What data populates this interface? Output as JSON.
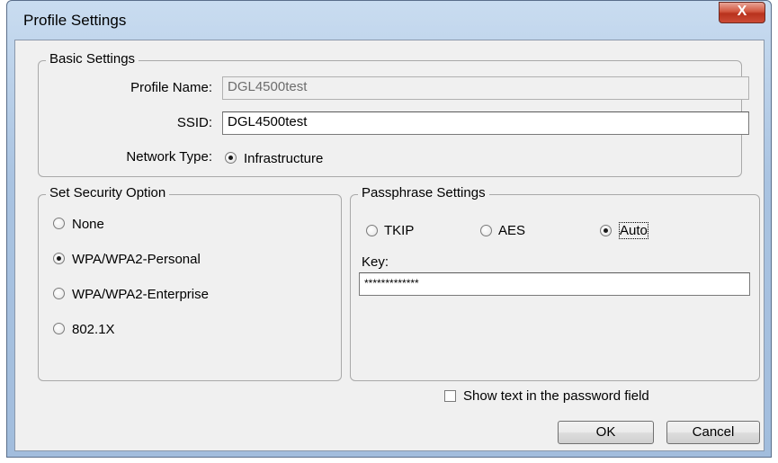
{
  "window": {
    "title": "Profile Settings",
    "close_glyph": "X"
  },
  "basic": {
    "legend": "Basic Settings",
    "profile_name_label": "Profile Name:",
    "profile_name_value": "DGL4500test",
    "ssid_label": "SSID:",
    "ssid_value": "DGL4500test",
    "network_type_label": "Network Type:",
    "network_type_option": "Infrastructure"
  },
  "security": {
    "legend": "Set Security Option",
    "options": [
      "None",
      "WPA/WPA2-Personal",
      "WPA/WPA2-Enterprise",
      "802.1X"
    ],
    "selected": "WPA/WPA2-Personal"
  },
  "passphrase": {
    "legend": "Passphrase Settings",
    "ciphers": [
      "TKIP",
      "AES",
      "Auto"
    ],
    "selected": "Auto",
    "key_label": "Key:",
    "key_value": "*************"
  },
  "show_text": {
    "label": "Show text in the password field",
    "checked": false
  },
  "buttons": {
    "ok": "OK",
    "cancel": "Cancel"
  }
}
